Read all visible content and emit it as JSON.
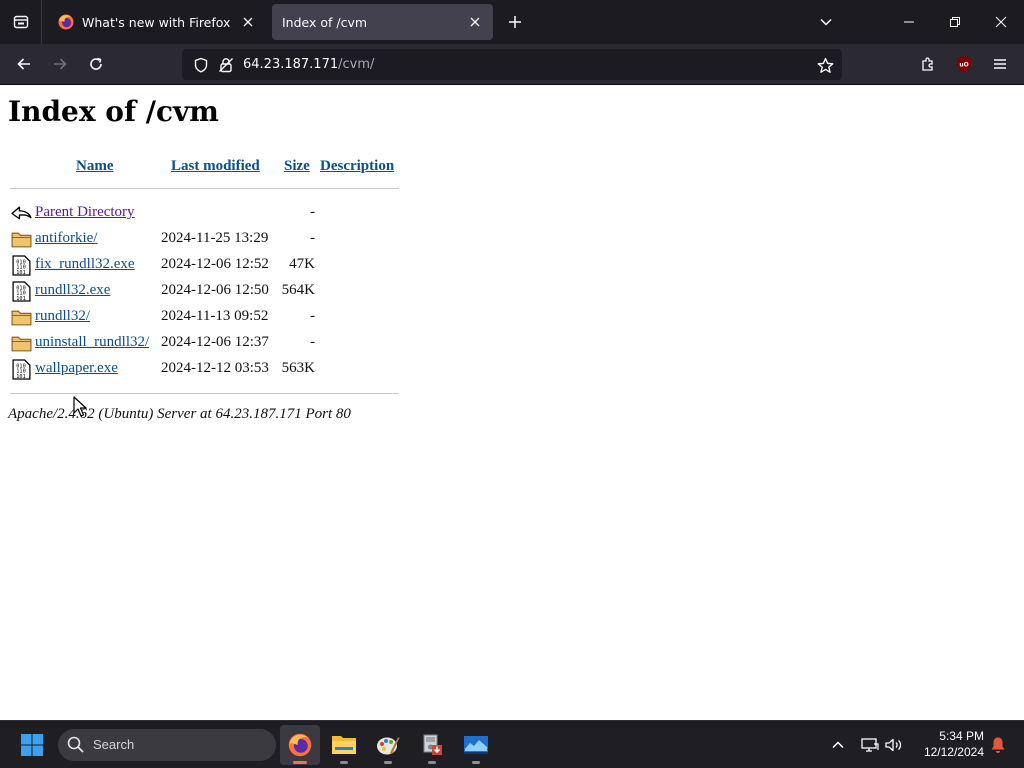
{
  "browser": {
    "tabs": [
      {
        "title": "What's new with Firefox",
        "active": false
      },
      {
        "title": "Index of /cvm",
        "active": true
      }
    ],
    "url": {
      "host": "64.23.187.171",
      "path": "/cvm/"
    },
    "extensions": {
      "ublock_badge": "uO"
    }
  },
  "page": {
    "heading": "Index of /cvm",
    "columns": {
      "name": "Name",
      "modified": "Last modified",
      "size": "Size",
      "description": "Description"
    },
    "entries": [
      {
        "icon": "back-icon",
        "name": "Parent Directory",
        "modified": "",
        "size": "-"
      },
      {
        "icon": "folder-icon",
        "name": "antiforkie/",
        "modified": "2024-11-25 13:29",
        "size": "-"
      },
      {
        "icon": "binary-file-icon",
        "name": "fix_rundll32.exe",
        "modified": "2024-12-06 12:52",
        "size": "47K"
      },
      {
        "icon": "binary-file-icon",
        "name": "rundll32.exe",
        "modified": "2024-12-06 12:50",
        "size": "564K"
      },
      {
        "icon": "folder-icon",
        "name": "rundll32/",
        "modified": "2024-11-13 09:52",
        "size": "-"
      },
      {
        "icon": "folder-icon",
        "name": "uninstall_rundll32/",
        "modified": "2024-12-06 12:37",
        "size": "-"
      },
      {
        "icon": "binary-file-icon",
        "name": "wallpaper.exe",
        "modified": "2024-12-12 03:53",
        "size": "563K"
      }
    ],
    "address": "Apache/2.4.62 (Ubuntu) Server at 64.23.187.171 Port 80"
  },
  "taskbar": {
    "search_placeholder": "Search",
    "apps": [
      "firefox-icon",
      "file-explorer-icon",
      "paint-icon",
      "installer-icon",
      "monitor-icon"
    ],
    "time": "5:34 PM",
    "date": "12/12/2024"
  },
  "colors": {
    "link": "#0b4f8a",
    "visited": "#551a8b",
    "tab_active": "#42414d",
    "toolbar": "#2b2a33",
    "tabstrip": "#1c1b22",
    "taskbar": "#1f1f23"
  }
}
